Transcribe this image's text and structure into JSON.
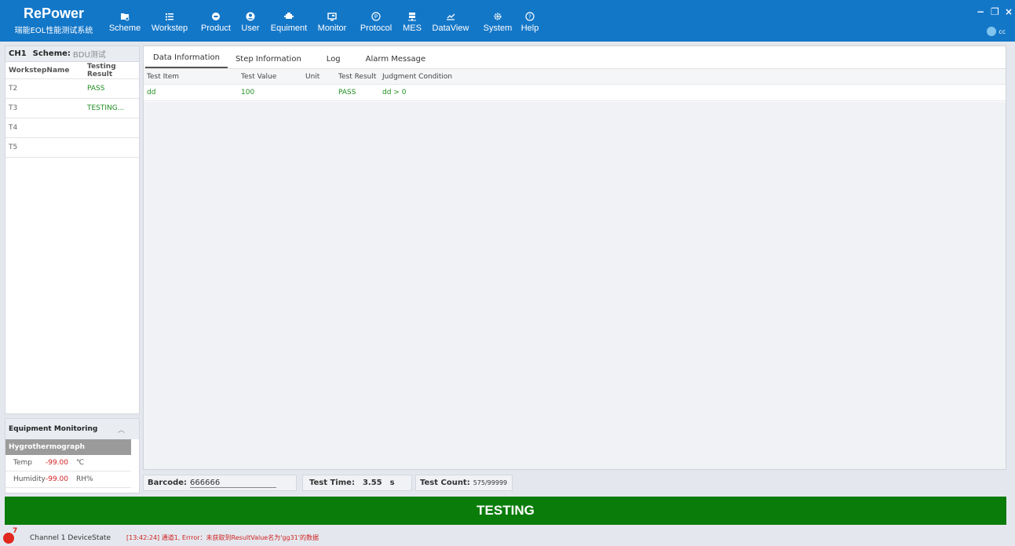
{
  "app": {
    "title": "RePower",
    "subtitle": "瑞能EOL性能测试系统",
    "user": "cc"
  },
  "nav": [
    {
      "label": "Scheme",
      "icon": "scheme-icon"
    },
    {
      "label": "Workstep",
      "icon": "list-icon"
    },
    {
      "label": "Product",
      "icon": "product-icon"
    },
    {
      "label": "User",
      "icon": "user-icon"
    },
    {
      "label": "Equiment",
      "icon": "equipment-icon"
    },
    {
      "label": "Monitor",
      "icon": "monitor-icon"
    },
    {
      "label": "Protocol",
      "icon": "protocol-icon"
    },
    {
      "label": "MES",
      "icon": "server-icon"
    },
    {
      "label": "DataView",
      "icon": "dataview-icon"
    },
    {
      "label": "System",
      "icon": "gear-icon"
    },
    {
      "label": "Help",
      "icon": "help-icon"
    }
  ],
  "window": {
    "minimize": "−",
    "restore": "❐",
    "close": "×"
  },
  "channel": {
    "name": "CH1",
    "scheme_label": "Scheme:",
    "scheme_value": "BDU测试"
  },
  "worksteps": {
    "headers": [
      "WorkstepName",
      "Testing Result"
    ],
    "rows": [
      {
        "name": "T2",
        "result": "PASS"
      },
      {
        "name": "T3",
        "result": "TESTING..."
      },
      {
        "name": "T4",
        "result": ""
      },
      {
        "name": "T5",
        "result": ""
      }
    ]
  },
  "equipment": {
    "title": "Equipment Monitoring",
    "group": "Hygrothermograph",
    "rows": [
      {
        "name": "Temp",
        "value": "-99.00",
        "unit": "℃"
      },
      {
        "name": "Humidity",
        "value": "-99.00",
        "unit": "RH%"
      }
    ]
  },
  "tabs": [
    "Data Information",
    "Step Information",
    "Log",
    "Alarm Message"
  ],
  "data_table": {
    "headers": [
      "Test Item",
      "Test Value",
      "Unit",
      "Test Result",
      "Judgment Condition"
    ],
    "rows": [
      {
        "item": "dd",
        "value": "100",
        "unit": "",
        "result": "PASS",
        "condition": "dd > 0"
      }
    ]
  },
  "info": {
    "barcode_label": "Barcode:",
    "barcode_value": "666666",
    "test_time_label": "Test Time:",
    "test_time_value": "3.55",
    "test_time_unit": "s",
    "test_count_label": "Test Count:",
    "test_count_value": "575/99999"
  },
  "status": "TESTING",
  "footer": {
    "alert_count": "7",
    "device_state": "Channel 1 DeviceState",
    "message": "[13:42:24] 通道1, Errror：未获取到ResultValue名为'gg31'的数据"
  },
  "colors": {
    "topbar": "#1377c8",
    "status_green": "#0a7c0a",
    "pass_green": "#1f8e1f",
    "alert_red": "#e0281f"
  }
}
